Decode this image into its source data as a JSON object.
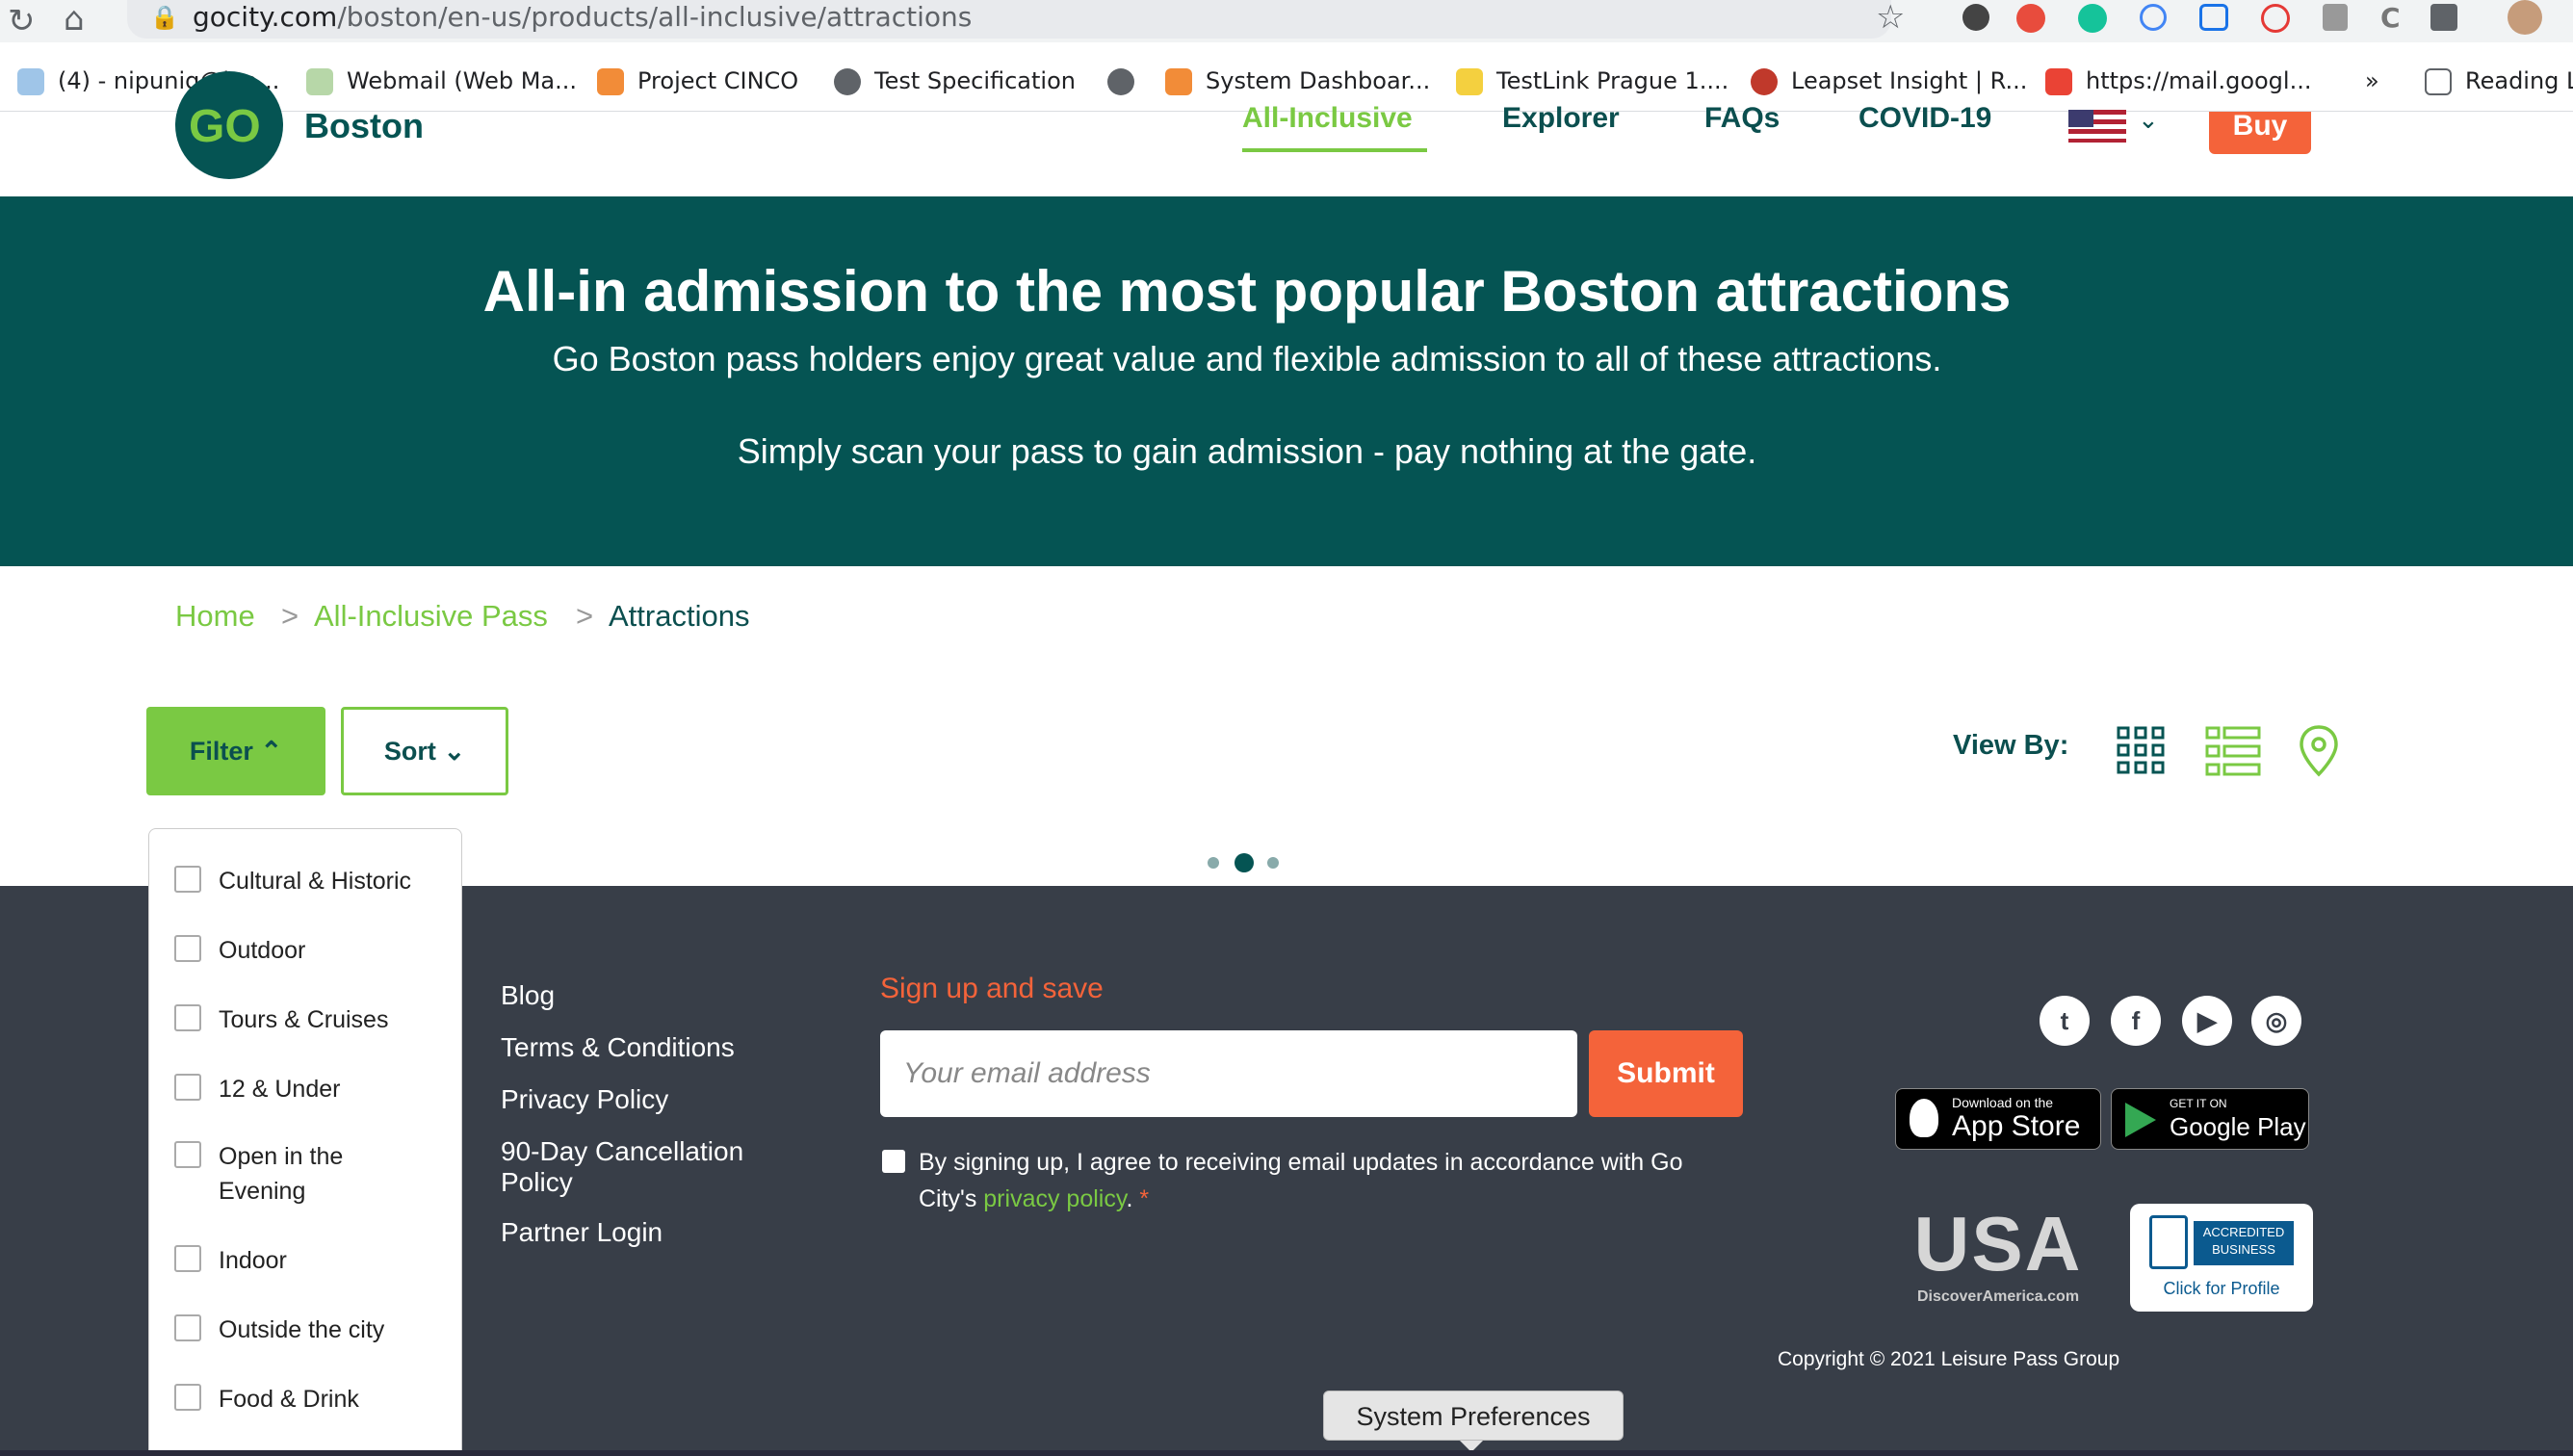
{
  "browser": {
    "url_host": "gocity.com",
    "url_path": "/boston/en-us/products/all-inclusive/attractions",
    "bookmarks": [
      "(4) - nipunig@lea...",
      "Webmail (Web Ma...",
      "Project CINCO",
      "Test Specification",
      "System Dashboar...",
      "TestLink Prague 1....",
      "Leapset Insight | R...",
      "https://mail.googl..."
    ],
    "overflow_label": "»",
    "reading_list": "Reading L"
  },
  "site": {
    "logo_text": "GO",
    "city": "Boston",
    "nav": [
      "All-Inclusive",
      "Explorer",
      "FAQs",
      "COVID-19"
    ],
    "buy_label": "Buy"
  },
  "hero": {
    "title": "All-in admission to the most popular Boston attractions",
    "subtitle": "Go Boston pass holders enjoy great value and flexible admission to all of these attractions.",
    "note": "Simply scan your pass to gain admission - pay nothing at the gate."
  },
  "breadcrumb": {
    "home": "Home",
    "sep": ">",
    "pass": "All-Inclusive Pass",
    "current": "Attractions"
  },
  "controls": {
    "filter_label": "Filter",
    "sort_label": "Sort",
    "view_by_label": "View By:"
  },
  "filter_options": [
    "Cultural & Historic",
    "Outdoor",
    "Tours & Cruises",
    "12 & Under",
    "Open in the Evening",
    "Indoor",
    "Outside the city",
    "Food & Drink"
  ],
  "footer": {
    "links": [
      "Blog",
      "Terms & Conditions",
      "Privacy Policy",
      "90-Day Cancellation Policy",
      "Partner Login"
    ],
    "signup_heading": "Sign up and save",
    "email_placeholder": "Your email address",
    "submit_label": "Submit",
    "consent_text": "By signing up, I agree to receiving email updates in accordance with Go City's",
    "privacy_link": "privacy policy",
    "consent_end": ".",
    "required_mark": "*",
    "app_store_small": "Download on the",
    "app_store_big": "App Store",
    "google_play_small": "GET IT ON",
    "google_play_big": "Google Play",
    "usa_badge": "USA",
    "usa_caption": "DiscoverAmerica.com",
    "bbb_line1": "ACCREDITED",
    "bbb_line2": "BUSINESS",
    "bbb_caption": "Click for Profile",
    "copyright": "Copyright © 2021 Leisure Pass Group"
  },
  "tooltip": "System Preferences",
  "colors": {
    "teal": "#055453",
    "green": "#7ac943",
    "orange": "#f4633a",
    "footer_bg": "#383e48"
  }
}
